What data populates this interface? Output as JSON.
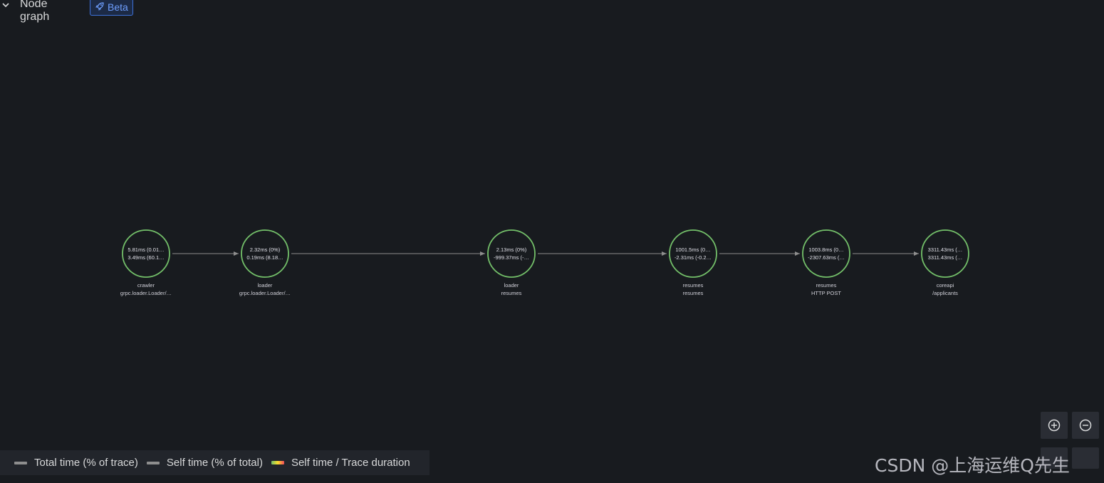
{
  "panel": {
    "title": "Node graph",
    "badge": "Beta"
  },
  "nodes": [
    {
      "id": "crawler",
      "stat1": "5.81ms (0.01…",
      "stat2": "3.49ms (60.1…",
      "title": "crawler",
      "subtitle": "grpc.loader.Loader/…"
    },
    {
      "id": "loader-grpc",
      "stat1": "2.32ms (0%)",
      "stat2": "0.19ms (8.18…",
      "title": "loader",
      "subtitle": "grpc.loader.Loader/…"
    },
    {
      "id": "loader-resumes",
      "stat1": "2.13ms (0%)",
      "stat2": "-999.37ms (-…",
      "title": "loader",
      "subtitle": "resumes"
    },
    {
      "id": "resumes-resumes",
      "stat1": "1001.5ms (0…",
      "stat2": "-2.31ms (-0.2…",
      "title": "resumes",
      "subtitle": "resumes"
    },
    {
      "id": "resumes-post",
      "stat1": "1003.8ms (0…",
      "stat2": "-2307.63ms (…",
      "title": "resumes",
      "subtitle": "HTTP POST"
    },
    {
      "id": "coreapi",
      "stat1": "3311.43ms (…",
      "stat2": "3311.43ms (…",
      "title": "coreapi",
      "subtitle": "/applicants"
    }
  ],
  "legend": {
    "items": [
      {
        "label": "Total time (% of trace)",
        "color": "#8e8e8e"
      },
      {
        "label": "Self time (% of total)",
        "color": "#8e8e8e"
      },
      {
        "label": "Self time / Trace duration",
        "color": "gradient"
      }
    ]
  },
  "colors": {
    "node_stroke": "#73bf69",
    "edge": "#8e8e8e",
    "background": "#181b1f"
  },
  "icons": {
    "zoom_in": "zoom-in-icon",
    "zoom_out": "zoom-out-icon",
    "collapse": "chevron-down-icon",
    "badge": "rocket-icon"
  },
  "watermark": "CSDN @上海运维Q先生"
}
